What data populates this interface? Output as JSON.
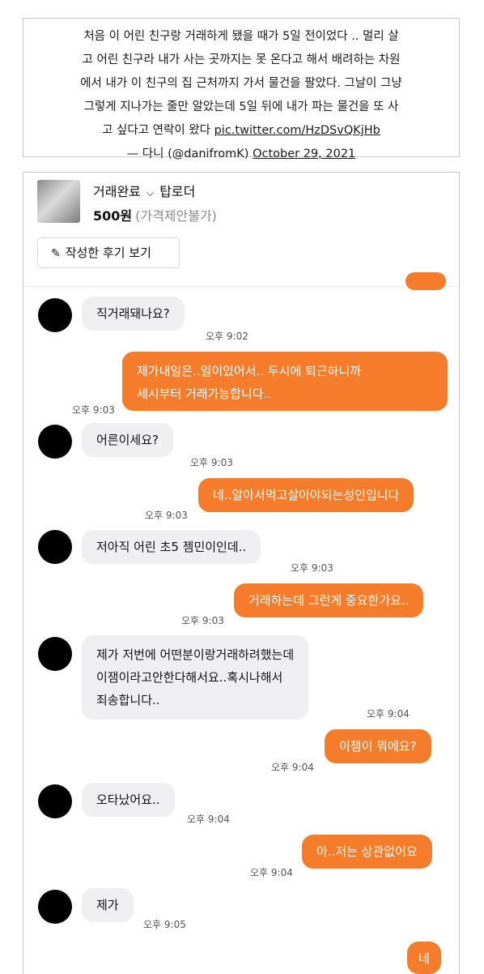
{
  "tweet": {
    "lines": [
      "처음 이 어린 친구랑 거래하게 됐을 때가 5일 전이었다 .. 멀리 살",
      "고 어린 친구라 내가 사는 곳까지는 못 온다고 해서 배려하는 차원",
      "에서 내가 이 친구의 집 근처까지 가서 물건을 팔았다. 그날이 그냥",
      "그렇게 지나가는 줄만 알았는데 5일 뒤에 내가 파는 물건을 또 사",
      "고 싶다고 연락이 왔다"
    ],
    "link": "pic.twitter.com/HzDSvQKjHb",
    "author": "— 다니 (@danifromK)",
    "date": "October 29, 2021"
  },
  "listing": {
    "status": "거래완료",
    "status_chevron": "⌵",
    "title": "탑로더",
    "price": "500원",
    "negotiation": "(가격제안불가)",
    "review_button": "작성한 후기 보기"
  },
  "messages": [
    {
      "side": "in",
      "lines": [
        "직거래돼나요?"
      ],
      "time": "오후 9:02"
    },
    {
      "side": "out",
      "lines": [
        "제가내일은..일이있어서.. 두시에 퇴근하니까",
        "세시부터 거래가능합니다.."
      ],
      "time": "오후 9:03"
    },
    {
      "side": "in",
      "lines": [
        "어른이세요?"
      ],
      "time": "오후 9:03"
    },
    {
      "side": "out",
      "lines": [
        "네..알아서먹고살아야되는성인입니다"
      ],
      "time": "오후 9:03"
    },
    {
      "side": "in",
      "lines": [
        "저아직 어린 초5 젬민이인데.."
      ],
      "time": "오후 9:03"
    },
    {
      "side": "out",
      "lines": [
        "거래하는데 그런게 중요한가요.."
      ],
      "time": "오후 9:03"
    },
    {
      "side": "in",
      "lines": [
        "제가 저번에 어떤분이랑거래하려했는데",
        "이잼이라고안한다해서요..혹시나해서",
        "죄송합니다.."
      ],
      "time": "오후 9:04"
    },
    {
      "side": "out",
      "lines": [
        "이잼이 뭐에요?"
      ],
      "time": "오후 9:04"
    },
    {
      "side": "in",
      "lines": [
        "오타났어요.."
      ],
      "time": "오후 9:04"
    },
    {
      "side": "out",
      "lines": [
        "아..저는 상관없어요"
      ],
      "time": "오후 9:04"
    },
    {
      "side": "in",
      "lines": [
        "제가"
      ],
      "time": "오후 9:05"
    },
    {
      "side": "out",
      "lines": [
        "네"
      ],
      "time": ""
    }
  ],
  "colors": {
    "accent": "#f47c2b",
    "incoming_bubble": "#efeff2"
  }
}
